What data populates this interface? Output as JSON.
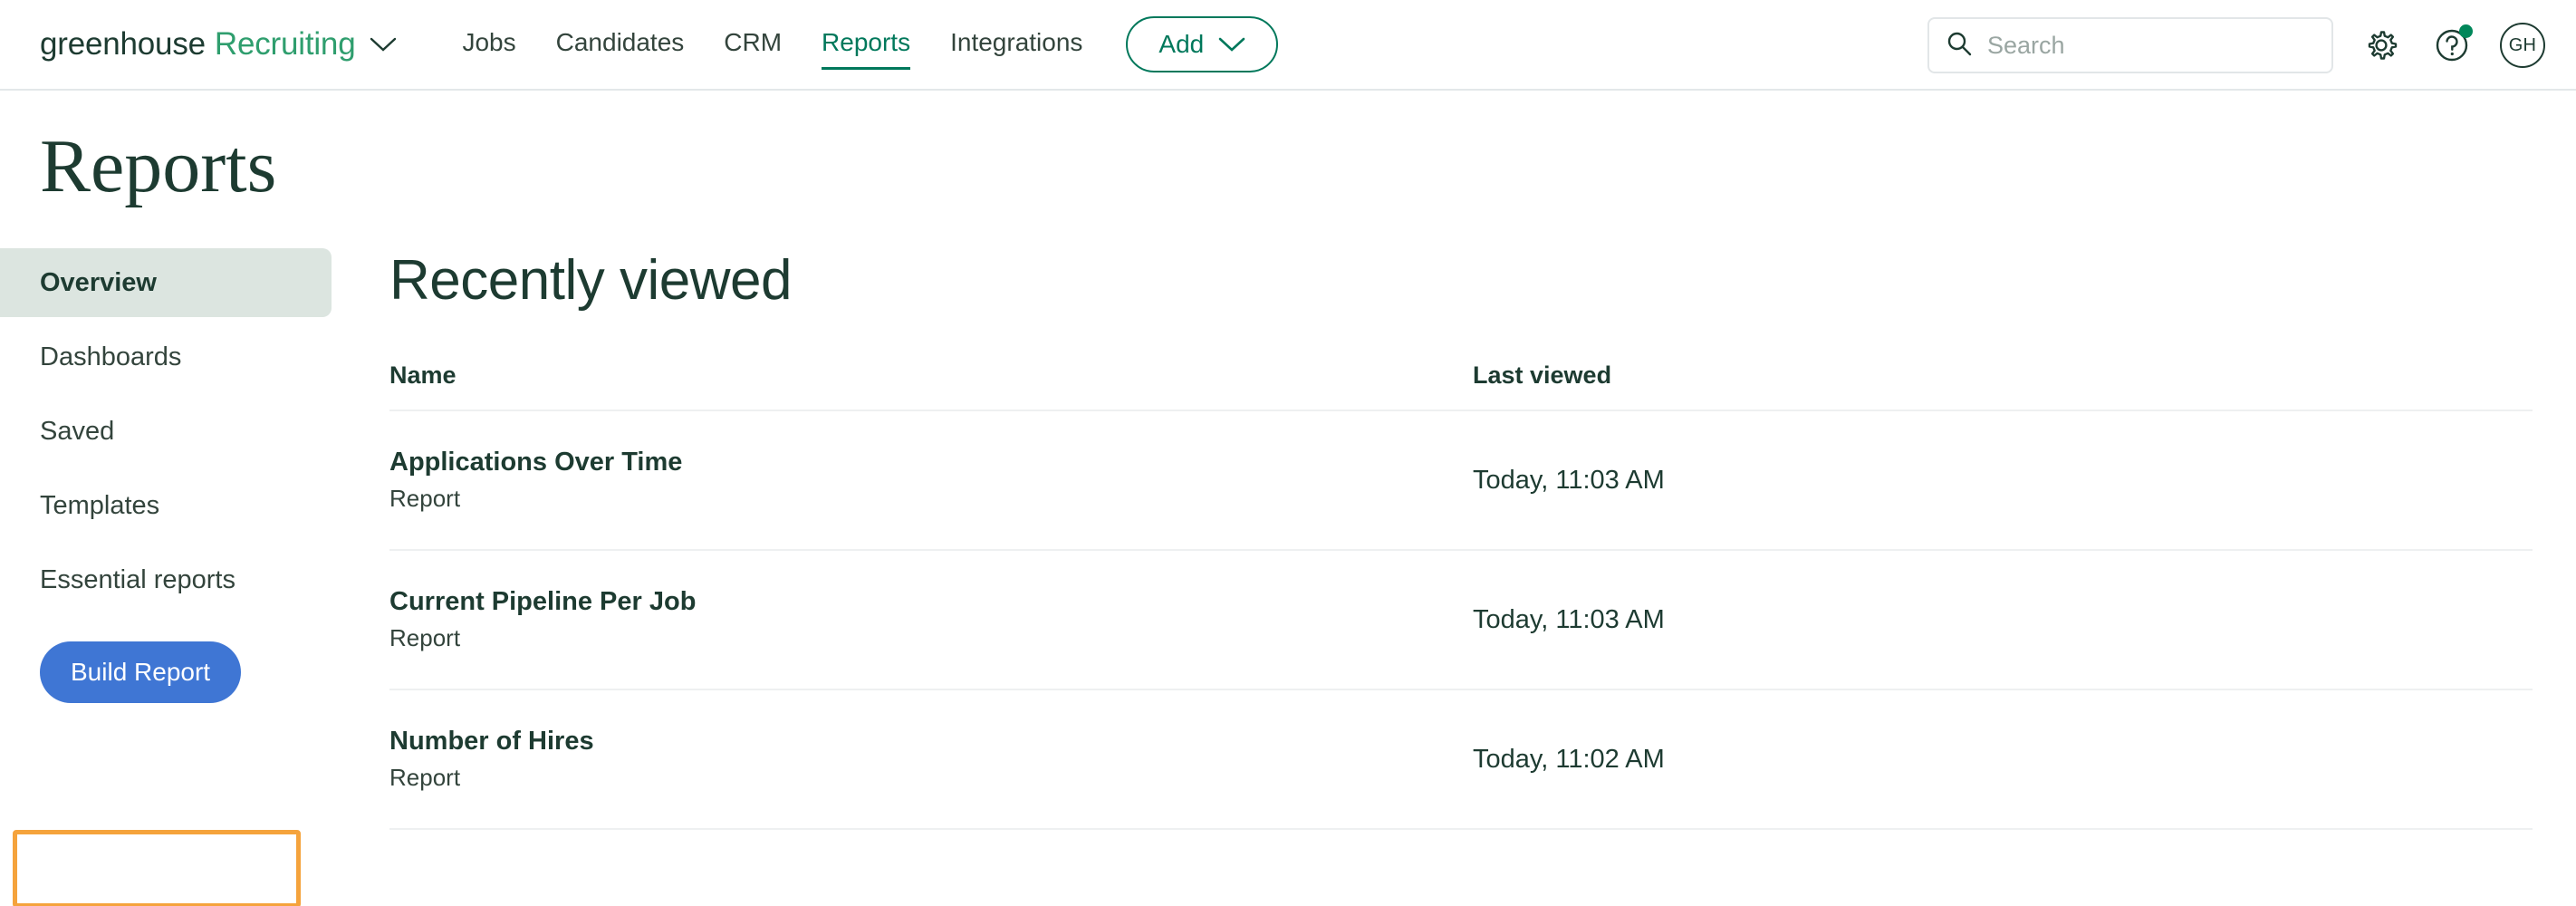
{
  "header": {
    "brand_primary": "greenhouse",
    "brand_product": "Recruiting",
    "brand_caret_icon": "chevron-down-icon",
    "nav_items": [
      {
        "label": "Jobs",
        "active": false
      },
      {
        "label": "Candidates",
        "active": false
      },
      {
        "label": "CRM",
        "active": false
      },
      {
        "label": "Reports",
        "active": true
      },
      {
        "label": "Integrations",
        "active": false
      }
    ],
    "add_button": {
      "label": "Add",
      "icon": "chevron-down-icon"
    },
    "search": {
      "placeholder": "Search",
      "value": "",
      "icon": "search-icon"
    },
    "settings_icon": "gear-icon",
    "help_icon": "question-mark-icon",
    "help_has_notification": true,
    "avatar_initials": "GH",
    "accent_green": "#00785b",
    "brand_green": "#2f9e6e",
    "dark_green": "#1d3b31"
  },
  "page": {
    "title": "Reports"
  },
  "sidebar": {
    "items": [
      {
        "label": "Overview",
        "active": true,
        "highlighted": false
      },
      {
        "label": "Dashboards",
        "active": false,
        "highlighted": false
      },
      {
        "label": "Saved",
        "active": false,
        "highlighted": false
      },
      {
        "label": "Templates",
        "active": false,
        "highlighted": false
      },
      {
        "label": "Essential reports",
        "active": false,
        "highlighted": true
      }
    ],
    "build_button_label": "Build Report",
    "build_button_color": "#3f76d4",
    "highlight_color": "#f5a33c",
    "active_bg": "#dce5e0"
  },
  "main": {
    "section_title": "Recently viewed",
    "columns": [
      {
        "key": "name",
        "label": "Name"
      },
      {
        "key": "last_viewed",
        "label": "Last viewed"
      }
    ],
    "rows": [
      {
        "name": "Applications Over Time",
        "type": "Report",
        "last_viewed": "Today, 11:03 AM"
      },
      {
        "name": "Current Pipeline Per Job",
        "type": "Report",
        "last_viewed": "Today, 11:03 AM"
      },
      {
        "name": "Number of Hires",
        "type": "Report",
        "last_viewed": "Today, 11:02 AM"
      }
    ]
  }
}
